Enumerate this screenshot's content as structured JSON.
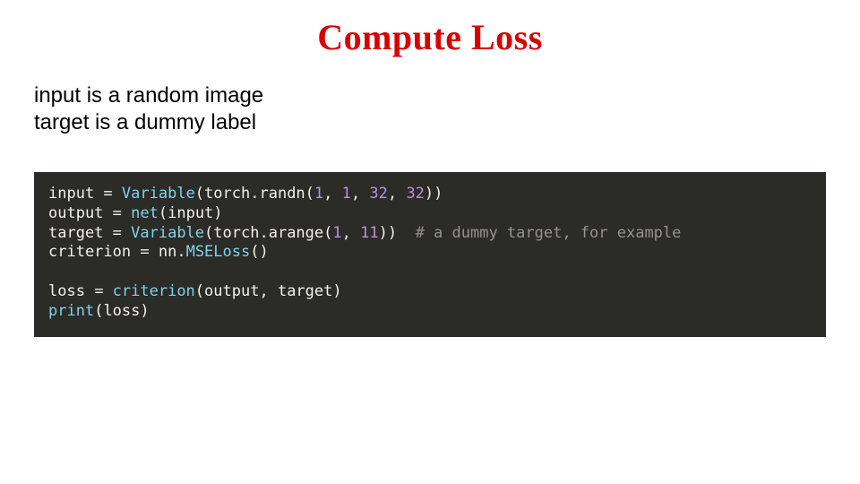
{
  "title": "Compute Loss",
  "desc_line1": "input is a random image",
  "desc_line2": "target is a dummy label",
  "code": {
    "l1": {
      "v_input": "input",
      "eq": " = ",
      "Variable": "Variable",
      "op1": "(",
      "torch": "torch",
      "dot1": ".",
      "randn": "randn",
      "op2": "(",
      "n1": "1",
      "c1": ", ",
      "n2": "1",
      "c2": ", ",
      "n3": "32",
      "c3": ", ",
      "n4": "32",
      "cl": "))"
    },
    "l2": {
      "v_output": "output",
      "eq": " = ",
      "net": "net",
      "op": "(",
      "arg": "input",
      "cl": ")"
    },
    "l3": {
      "v_target": "target",
      "eq": " = ",
      "Variable": "Variable",
      "op1": "(",
      "torch": "torch",
      "dot": ".",
      "arange": "arange",
      "op2": "(",
      "n1": "1",
      "c1": ", ",
      "n2": "11",
      "cl": "))",
      "sp": "  ",
      "comment": "# a dummy target, for example"
    },
    "l4": {
      "v_crit": "criterion",
      "eq": " = ",
      "nn": "nn",
      "dot": ".",
      "MSELoss": "MSELoss",
      "parens": "()"
    },
    "l5_blank": " ",
    "l6": {
      "v_loss": "loss",
      "eq": " = ",
      "criterion": "criterion",
      "op": "(",
      "a1": "output",
      "c": ", ",
      "a2": "target",
      "cl": ")"
    },
    "l7": {
      "print": "print",
      "op": "(",
      "arg": "loss",
      "cl": ")"
    }
  }
}
